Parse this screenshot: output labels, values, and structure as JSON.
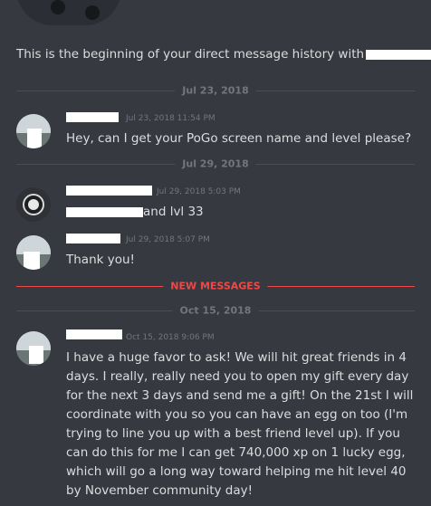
{
  "intro": {
    "text": "This is the beginning of your direct message history with"
  },
  "dividers": {
    "d1": "Jul 23, 2018",
    "d2": "Jul 29, 2018",
    "new": "NEW MESSAGES",
    "d3": "Oct 15, 2018"
  },
  "messages": [
    {
      "timestamp": "Jul 23, 2018 11:54 PM",
      "text": "Hey, can I get your PoGo screen name and level please?"
    },
    {
      "timestamp": "Jul 29, 2018 5:03 PM",
      "text": "and lvl 33"
    },
    {
      "timestamp": "Jul 29, 2018 5:07 PM",
      "text": "Thank you!"
    },
    {
      "timestamp": "Oct 15, 2018 9:06 PM",
      "text": "I have a huge favor to ask! We will hit great friends in 4 days. I really, really need you to open my gift every day for the next 3 days and send me a gift! On the 21st I will coordinate with you so you can have an egg on too (I'm trying to line you up with a best friend level up). If you can do this for me I can get 740,000 xp on 1 lucky egg, which will go a long way toward helping me hit level 40 by November community day!"
    }
  ],
  "colors": {
    "background": "#36393f",
    "text": "#dcddde",
    "muted": "#72767d",
    "new_messages": "#f04747"
  }
}
